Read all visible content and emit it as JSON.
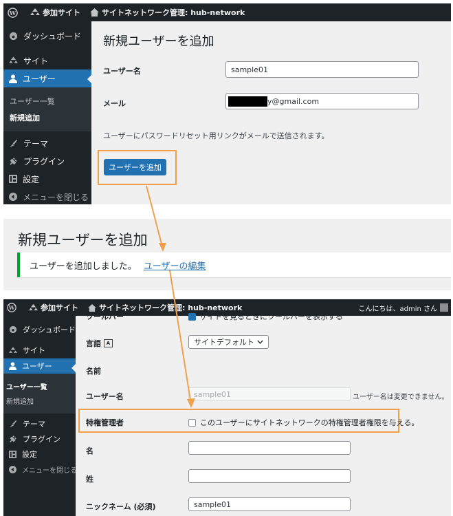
{
  "colors": {
    "accent": "#2271b1",
    "admin_bar": "#1d2327",
    "highlight": "#f0a04b"
  },
  "top": {
    "adminbar": {
      "site_label": "参加サイト",
      "network_label": "サイトネットワーク管理: hub-network"
    },
    "menu": [
      "ダッシュボード",
      "サイト",
      "ユーザー",
      "テーマ",
      "プラグイン",
      "設定",
      "メニューを閉じる"
    ],
    "submenu": [
      "ユーザー一覧",
      "新規追加"
    ],
    "page_title": "新規ユーザーを追加",
    "username_label": "ユーザー名",
    "username_value": "sample01",
    "email_label": "メール",
    "email_value": "y@gmail.com",
    "note": "ユーザーにパスワードリセット用リンクがメールで送信されます。",
    "add_button": "ユーザーを追加"
  },
  "middle": {
    "title": "新規ユーザーを追加",
    "notice_text": "ユーザーを追加しました。",
    "notice_link": "ユーザーの編集"
  },
  "bottom": {
    "adminbar": {
      "site_label": "参加サイト",
      "network_label": "サイトネットワーク管理: hub-network",
      "greeting": "こんにちは、admin さん"
    },
    "menu": [
      "ダッシュボード",
      "サイト",
      "ユーザー",
      "テーマ",
      "プラグイン",
      "設定",
      "メニューを閉じる"
    ],
    "submenu": [
      "ユーザー一覧",
      "新規追加"
    ],
    "toolbar_partial_label": "ツールバー",
    "toolbar_partial_text": "サイトを見るときにツールバーを表示する",
    "language_label": "言語",
    "language_value": "サイトデフォルト",
    "name_heading": "名前",
    "username_label": "ユーザー名",
    "username_value": "sample01",
    "username_note": "ユーザー名は変更できません。",
    "superadmin_label": "特権管理者",
    "superadmin_text": "このユーザーにサイトネットワークの特権管理者権限を与える。",
    "first_name_label": "名",
    "last_name_label": "姓",
    "nickname_label": "ニックネーム (必須)",
    "nickname_value": "sample01"
  }
}
